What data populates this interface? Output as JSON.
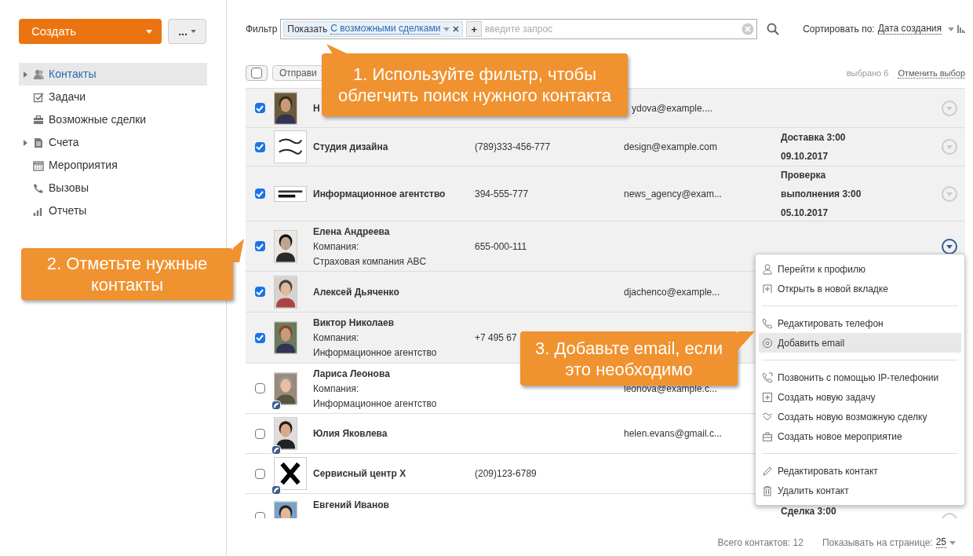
{
  "create_button": "Создать",
  "more_button": "...",
  "sidebar": {
    "items": [
      {
        "label": "Контакты",
        "expandable": true,
        "selected": true
      },
      {
        "label": "Задачи",
        "expandable": false,
        "selected": false
      },
      {
        "label": "Возможные сделки",
        "expandable": false,
        "selected": false
      },
      {
        "label": "Счета",
        "expandable": true,
        "selected": false
      },
      {
        "label": "Мероприятия",
        "expandable": false,
        "selected": false
      },
      {
        "label": "Вызовы",
        "expandable": false,
        "selected": false
      },
      {
        "label": "Отчеты",
        "expandable": false,
        "selected": false
      }
    ]
  },
  "filter": {
    "label": "Фильтр",
    "tag_label": "Показать",
    "tag_value": "С возможными сделками",
    "add_button": "+",
    "placeholder": "введите запрос"
  },
  "sort": {
    "label": "Сортировать по:",
    "value": "Дата создания"
  },
  "toolbar": {
    "select_all_checked": false,
    "send_button": "Отправи",
    "selected_count": "выбрано 6",
    "clear_selection": "Отменить выбор"
  },
  "rows": [
    {
      "name": "Н",
      "checked": true,
      "badge": false,
      "menu_open": false,
      "email": "ydova@example...."
    },
    {
      "name": "Студия дизайна",
      "checked": true,
      "badge": false,
      "menu_open": false,
      "phone": "(789)333-456-777",
      "email": "design@example.com",
      "activity": [
        "Доставка 3:00",
        "09.10.2017"
      ]
    },
    {
      "name": "Информационное агентство",
      "checked": true,
      "badge": false,
      "menu_open": false,
      "phone": "394-555-777",
      "email": "news_agency@exam...",
      "activity": [
        "Проверка",
        "выполнения 3:00",
        "05.10.2017"
      ]
    },
    {
      "name": "Елена Андреева",
      "company_label": "Компания:",
      "company": "Страховая компания ABC",
      "checked": true,
      "badge": false,
      "menu_open": true,
      "phone": "655-000-111"
    },
    {
      "name": "Алексей Дьяченко",
      "checked": true,
      "badge": false,
      "email": "djachenco@example..."
    },
    {
      "name": "Виктор Николаев",
      "company_label": "Компания:",
      "company": "Информационное агентство",
      "checked": true,
      "badge": false,
      "phone": "+7 495 67"
    },
    {
      "name": "Лариса Леонова",
      "company_label": "Компания:",
      "company": "Информационное агентство",
      "checked": false,
      "badge": true,
      "email": "leonova@example.c..."
    },
    {
      "name": "Юлия Яковлева",
      "checked": false,
      "badge": true,
      "email": "helen.evans@gmail.c..."
    },
    {
      "name": "Сервисный центр X",
      "checked": false,
      "badge": true,
      "phone": "(209)123-6789"
    },
    {
      "name": "Евгений Иванов",
      "checked": false,
      "badge": false,
      "menu_open": false,
      "activity": [
        "Сделка 3:00"
      ]
    }
  ],
  "menu": {
    "groups": [
      [
        {
          "label": "Перейти к профилю",
          "selected": false
        },
        {
          "label": "Открыть в новой вкладке",
          "selected": false
        }
      ],
      [
        {
          "label": "Редактировать телефон",
          "selected": false
        },
        {
          "label": "Добавить email",
          "selected": true
        }
      ],
      [
        {
          "label": "Позвонить с помощью IP-телефонии",
          "selected": false
        },
        {
          "label": "Создать новую задачу",
          "selected": false
        },
        {
          "label": "Создать новую возможную сделку",
          "selected": false
        },
        {
          "label": "Создать новое мероприятие",
          "selected": false
        }
      ],
      [
        {
          "label": "Редактировать контакт",
          "selected": false
        },
        {
          "label": "Удалить контакт",
          "selected": false
        }
      ]
    ]
  },
  "callouts": [
    {
      "text": "1. Используйте фильтр, чтобы облегчить поиск нужного контакта"
    },
    {
      "text": "2. Отметьте нужные контакты"
    },
    {
      "text": "3. Добавьте email, если это необходимо"
    }
  ],
  "footer": {
    "total": "Всего контактов: 12",
    "per_page_label": "Показывать на странице:",
    "per_page": "25"
  }
}
